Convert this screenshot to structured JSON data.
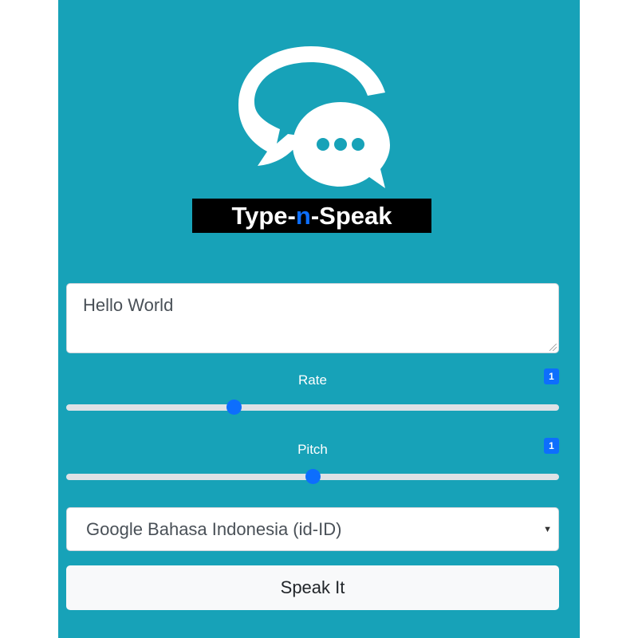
{
  "logo": {
    "icon": "chat-bubbles-icon",
    "text_part1": "Type-",
    "text_accent": "n",
    "text_part2": "-Speak"
  },
  "text_input": {
    "value": "Hello World"
  },
  "rate": {
    "label": "Rate",
    "badge": "1",
    "level_fraction": 0.34
  },
  "pitch": {
    "label": "Pitch",
    "badge": "1",
    "level_fraction": 0.5
  },
  "voice_select": {
    "selected": "Google Bahasa Indonesia (id-ID)"
  },
  "speak_button": {
    "label": "Speak It"
  },
  "colors": {
    "panel": "#17a2b8",
    "accent": "#0d6efd"
  }
}
